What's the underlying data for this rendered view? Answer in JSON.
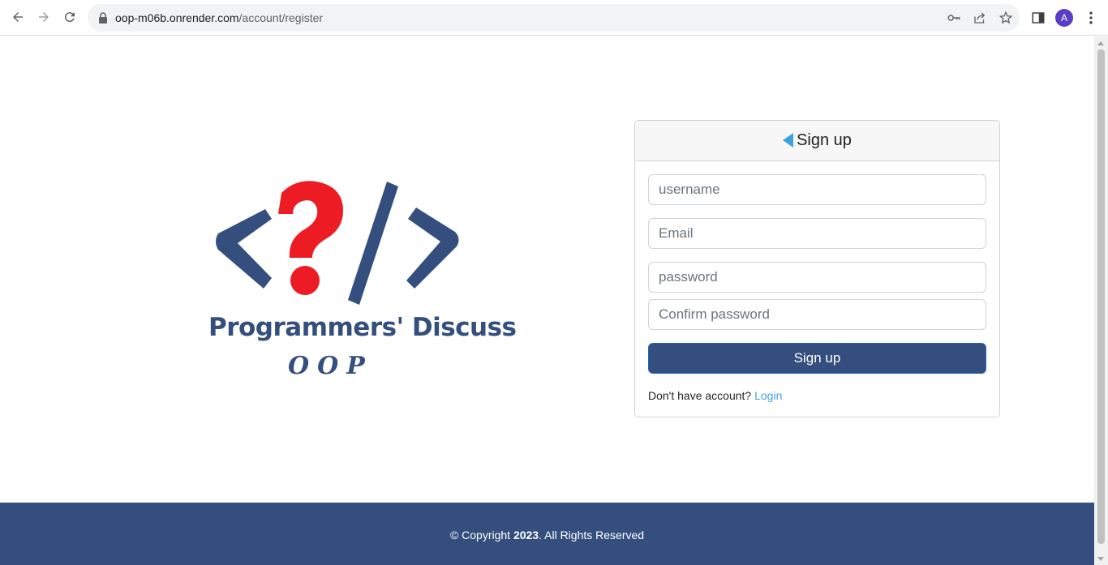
{
  "browser": {
    "url_host": "oop-m06b.onrender.com",
    "url_path": "/account/register",
    "profile_initial": "A"
  },
  "logo": {
    "title": "Programmers' Discuss",
    "subtitle": "OOP"
  },
  "signup": {
    "heading": "Sign up",
    "username_placeholder": "username",
    "email_placeholder": "Email",
    "password_placeholder": "password",
    "confirm_placeholder": "Confirm password",
    "submit_label": "Sign up",
    "hint_text": "Don't have account?",
    "login_link": "Login"
  },
  "footer": {
    "prefix": "© Copyright ",
    "year": "2023",
    "suffix": ". All Rights Reserved"
  },
  "colors": {
    "brand_navy": "#344f7e",
    "accent_blue": "#3ba3e0",
    "logo_red": "#ed1c24"
  }
}
